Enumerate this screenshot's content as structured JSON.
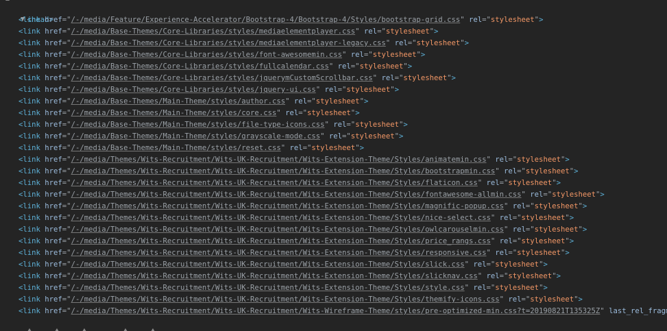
{
  "head_tag": "<head>",
  "link_tag_open": "<link",
  "href_attr": "href",
  "rel_attr": "rel",
  "rel_value": "stylesheet",
  "links": [
    "/-/media/Feature/Experience-Accelerator/Bootstrap-4/Bootstrap-4/Styles/bootstrap-grid.css",
    "/-/media/Base-Themes/Core-Libraries/styles/mediaelementplayer.css",
    "/-/media/Base-Themes/Core-Libraries/styles/mediaelementplayer-legacy.css",
    "/-/media/Base-Themes/Core-Libraries/styles/font-awesomemin.css",
    "/-/media/Base-Themes/Core-Libraries/styles/fullcalendar.css",
    "/-/media/Base-Themes/Core-Libraries/styles/jquerymCustomScrollbar.css",
    "/-/media/Base-Themes/Core-Libraries/styles/jquery-ui.css",
    "/-/media/Base-Themes/Main-Theme/styles/author.css",
    "/-/media/Base-Themes/Main-Theme/styles/core.css",
    "/-/media/Base-Themes/Main-Theme/styles/file-type-icons.css",
    "/-/media/Base-Themes/Main-Theme/styles/grayscale-mode.css",
    "/-/media/Base-Themes/Main-Theme/styles/reset.css",
    "/-/media/Themes/Wits-Recruitment/Wits-UK-Recruitment/Wits-Extension-Theme/Styles/animatemin.css",
    "/-/media/Themes/Wits-Recruitment/Wits-UK-Recruitment/Wits-Extension-Theme/Styles/bootstrapmin.css",
    "/-/media/Themes/Wits-Recruitment/Wits-UK-Recruitment/Wits-Extension-Theme/Styles/flaticon.css",
    "/-/media/Themes/Wits-Recruitment/Wits-UK-Recruitment/Wits-Extension-Theme/Styles/fontawesome-allmin.css",
    "/-/media/Themes/Wits-Recruitment/Wits-UK-Recruitment/Wits-Extension-Theme/Styles/magnific-popup.css",
    "/-/media/Themes/Wits-Recruitment/Wits-UK-Recruitment/Wits-Extension-Theme/Styles/nice-select.css",
    "/-/media/Themes/Wits-Recruitment/Wits-UK-Recruitment/Wits-Extension-Theme/Styles/owlcarouselmin.css",
    "/-/media/Themes/Wits-Recruitment/Wits-UK-Recruitment/Wits-Extension-Theme/Styles/price_rangs.css",
    "/-/media/Themes/Wits-Recruitment/Wits-UK-Recruitment/Wits-Extension-Theme/Styles/responsive.css",
    "/-/media/Themes/Wits-Recruitment/Wits-UK-Recruitment/Wits-Extension-Theme/Styles/slick.css",
    "/-/media/Themes/Wits-Recruitment/Wits-UK-Recruitment/Wits-Extension-Theme/Styles/slicknav.css",
    "/-/media/Themes/Wits-Recruitment/Wits-UK-Recruitment/Wits-Extension-Theme/Styles/style.css",
    "/-/media/Themes/Wits-Recruitment/Wits-UK-Recruitment/Wits-Extension-Theme/Styles/themify-icons.css",
    "/-/media/Themes/Wits-Recruitment/Wits-UK-Recruitment/Wits-Wireframe-Theme/styles/pre-optimized-min.css?t=20190821T135325Z"
  ],
  "last_rel_fragment_1": "rel=",
  "last_rel_fragment_2": "sheet",
  "colors": {
    "background": "#242424",
    "tag": "#5db0d7",
    "attribute": "#9bbbdc",
    "value": "#f29766",
    "text": "#9aa0a6"
  },
  "icons": {
    "head_toggle": "expand-triangle-down"
  }
}
